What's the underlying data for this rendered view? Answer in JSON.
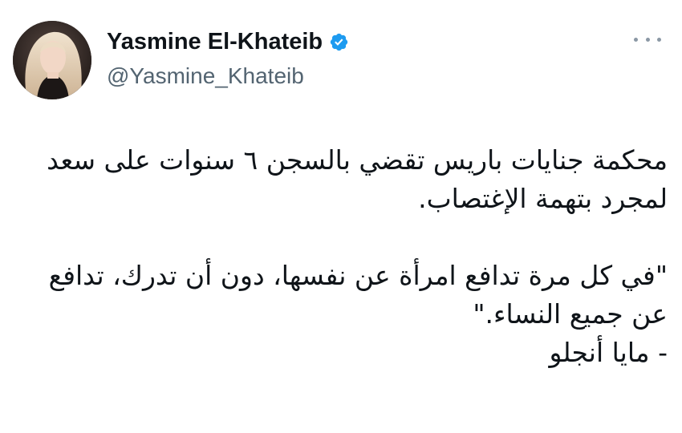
{
  "author": {
    "name": "Yasmine El-Khateib",
    "handle": "@Yasmine_Khateib",
    "verified": true,
    "verified_badge_color": "#1d9bf0"
  },
  "menu_icon": "more-dots-icon",
  "tweet": {
    "lines": [
      "محكمة جنايات باريس تقضي بالسجن ٦ سنوات على سعد",
      "لمجرد بتهمة الإغتصاب.",
      "\"في كل مرة تدافع امرأة عن نفسها، دون أن تدرك، تدافع",
      "عن جميع النساء.\"",
      "- مايا أنجلو"
    ]
  },
  "colors": {
    "text": "#0f1419",
    "secondary": "#536471",
    "background": "#ffffff"
  }
}
